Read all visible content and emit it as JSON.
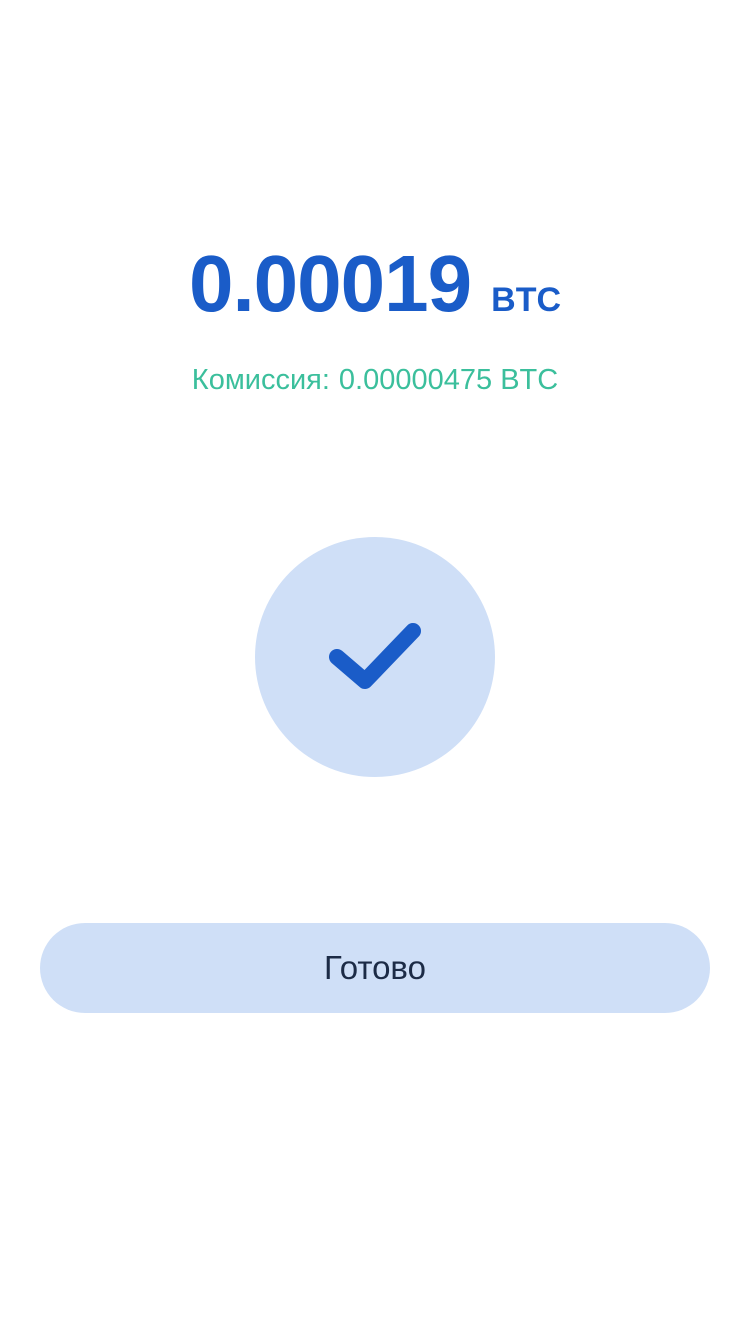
{
  "transfer": {
    "amount": "0.00019",
    "currency": "BTC",
    "fee_label": "Комиссия:",
    "fee_amount": "0.00000475 BTC"
  },
  "status_icon": "checkmark-icon",
  "done_button": {
    "label": "Готово"
  },
  "colors": {
    "background": "#ffffff",
    "accent_blue": "#1a5cc8",
    "fee_green": "#3bbf9c",
    "light_blue": "#cfdff7",
    "button_text": "#1c2b46"
  }
}
